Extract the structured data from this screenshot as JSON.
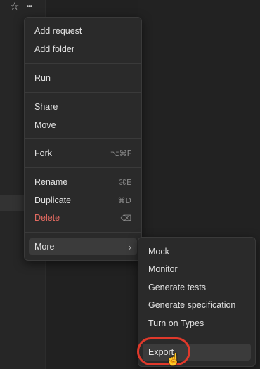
{
  "toolbar": {
    "star_icon": "star-icon",
    "more_icon": "more-horizontal-icon",
    "more_glyph": "•••"
  },
  "context_menu": {
    "items": [
      {
        "label": "Add request"
      },
      {
        "label": "Add folder"
      },
      {
        "label": "Run"
      },
      {
        "label": "Share"
      },
      {
        "label": "Move"
      },
      {
        "label": "Fork",
        "shortcut": "⌥⌘F"
      },
      {
        "label": "Rename",
        "shortcut": "⌘E"
      },
      {
        "label": "Duplicate",
        "shortcut": "⌘D"
      },
      {
        "label": "Delete",
        "shortcut": "⌫"
      },
      {
        "label": "More",
        "chevron": "›"
      }
    ],
    "danger_color": "#e56b61"
  },
  "more_submenu": {
    "items": [
      {
        "label": "Mock"
      },
      {
        "label": "Monitor"
      },
      {
        "label": "Generate tests"
      },
      {
        "label": "Generate specification"
      },
      {
        "label": "Turn on Types"
      },
      {
        "label": "Export"
      }
    ]
  },
  "annotation": {
    "color": "#e0392b"
  }
}
